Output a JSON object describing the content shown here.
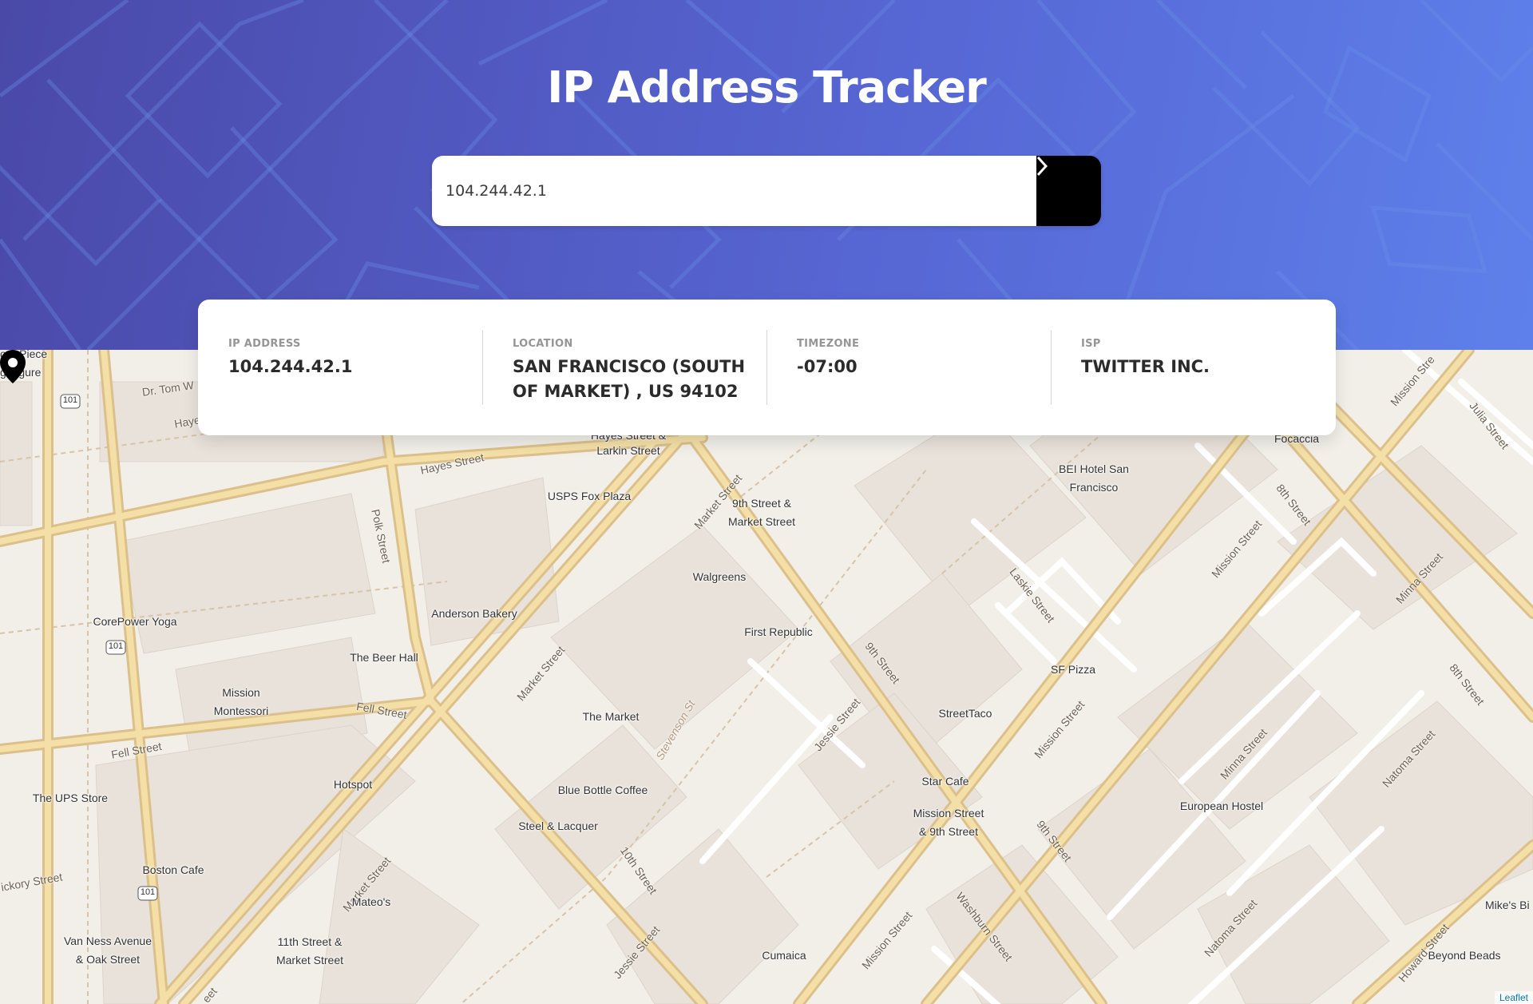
{
  "app": {
    "title": "IP Address Tracker"
  },
  "search": {
    "value": "104.244.42.1",
    "submit_icon": "chevron-right-icon"
  },
  "info": [
    {
      "label": "IP ADDRESS",
      "value": "104.244.42.1"
    },
    {
      "label": "LOCATION",
      "value": "SAN FRANCISCO (SOUTH OF MARKET) , US 94102"
    },
    {
      "label": "TIMEZONE",
      "value": "-07:00"
    },
    {
      "label": "ISP",
      "value": "TWITTER INC."
    }
  ],
  "map": {
    "attribution": "Leaflet",
    "marker_icon": "map-pin-icon",
    "pois": [
      "our Piece",
      "g Figure",
      "Hayes Street &",
      "Larkin Street",
      "BEI Hotel San",
      "Francisco",
      "Focaccia",
      "USPS Fox Plaza",
      "9th Street &",
      "Market Street",
      "Walgreens",
      "First Republic",
      "Anderson Bakery",
      "CorePower Yoga",
      "The Beer Hall",
      "Mission",
      "Montessori",
      "SF Pizza",
      "StreetTaco",
      "The Market",
      "Star Cafe",
      "Mission Street",
      "& 9th Street",
      "European Hostel",
      "Hotspot",
      "The UPS Store",
      "Blue Bottle Coffee",
      "Steel & Lacquer",
      "Boston Cafe",
      "Mateo's",
      "Van Ness Avenue",
      "& Oak Street",
      "11th Street &",
      "Market Street",
      "Cumaica",
      "Mike's Bi",
      "Beyond Beads"
    ],
    "streets": [
      "Dr. Tom W",
      "Hayes Street",
      "Hayes Street",
      "Polk Street",
      "Market Street",
      "Market Street",
      "Market Street",
      "Fell Street",
      "Fell Street",
      "Stevenson St",
      "Jessie Street",
      "9th Street",
      "9th Street",
      "Laskie Street",
      "Mission Street",
      "Mission Street",
      "Mission Street",
      "Mission Stre",
      "8th Street",
      "8th Street",
      "Minna Street",
      "Minna Street",
      "Natoma Street",
      "Natoma Street",
      "Julia Street",
      "Washburn Street",
      "10th Street",
      "Jessie Street",
      "ickory Street",
      "Howard Street",
      "eet"
    ],
    "highway_shields": [
      "101",
      "101",
      "101"
    ]
  }
}
